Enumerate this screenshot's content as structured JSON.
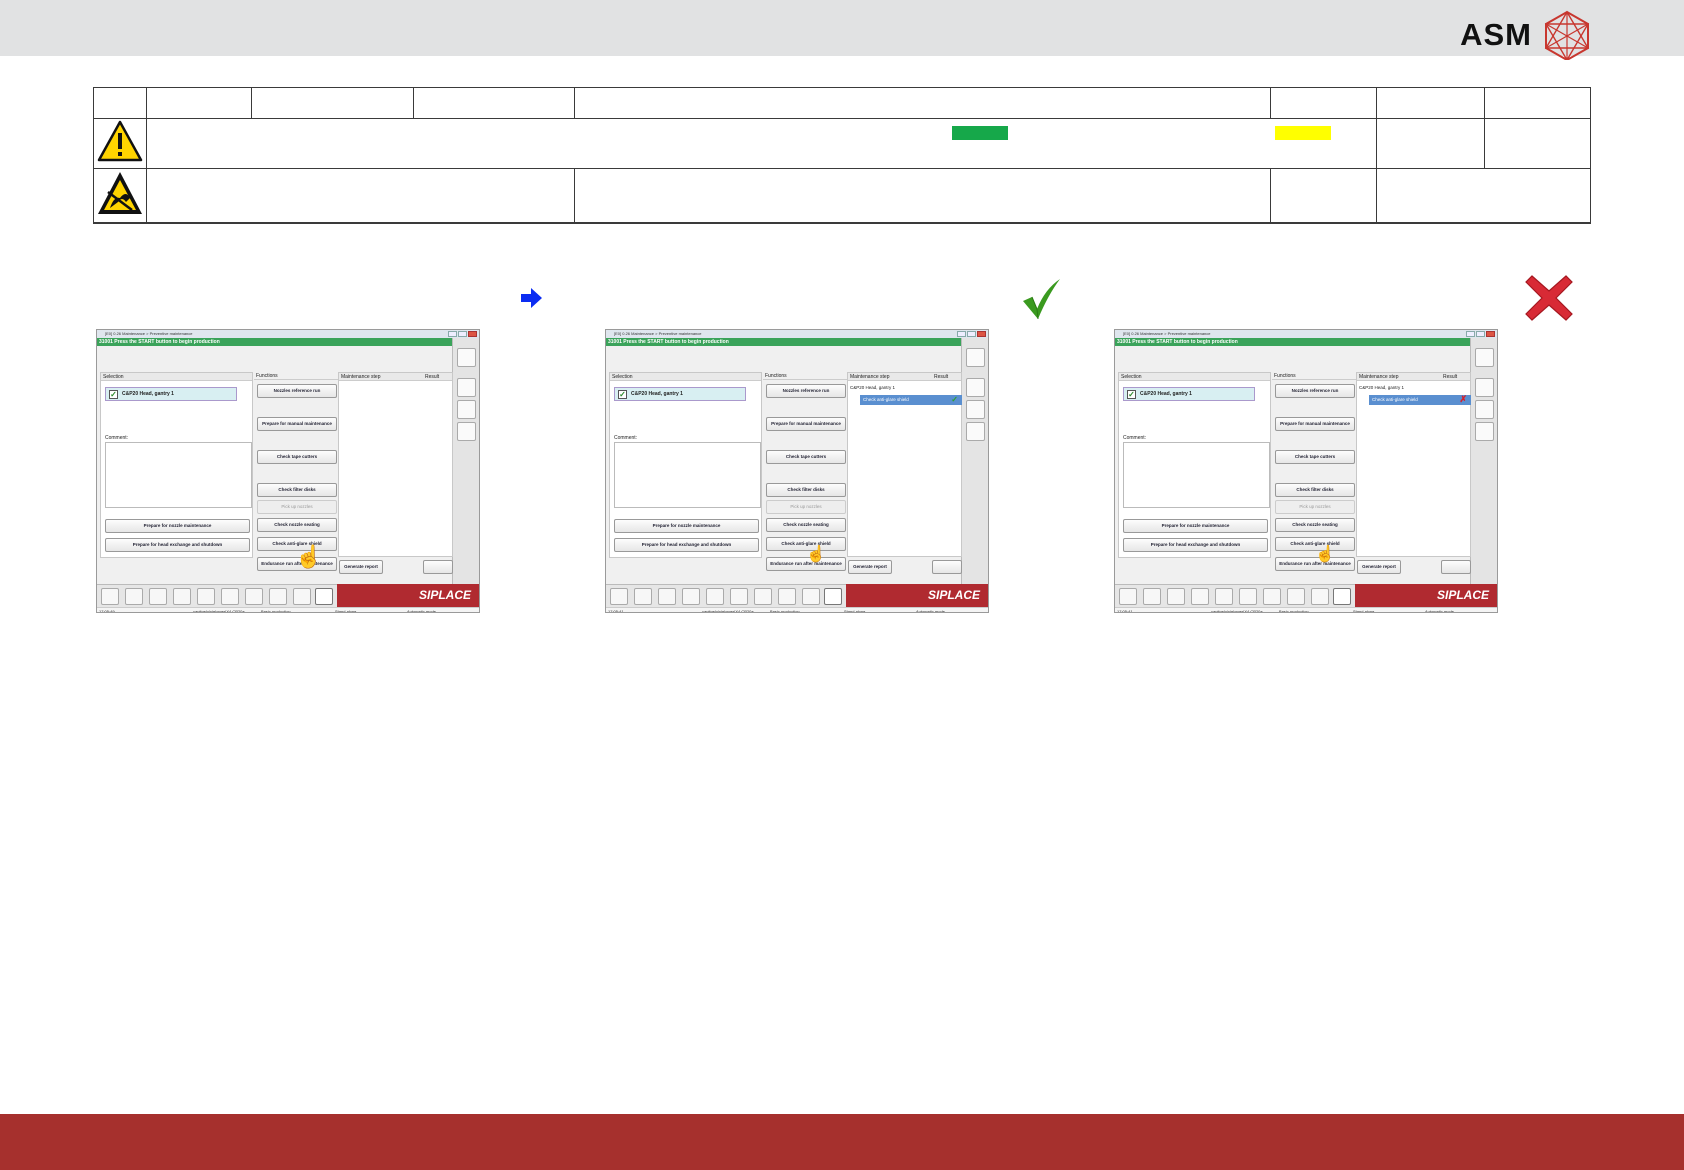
{
  "brand": {
    "logo_text": "ASM"
  },
  "colors": {
    "header_band": "#e1e2e3",
    "footer_band": "#a6302d",
    "swatch_green": "#16a84a",
    "swatch_yellow": "#ffff00",
    "arrow_blue": "#0b2cf2",
    "check_green": "#3a9a1f",
    "cross_red": "#d82a35"
  },
  "markers": {
    "arrow": "arrow-right-icon",
    "check": "check-icon",
    "cross": "cross-icon"
  },
  "screens": [
    {
      "title": "[E0] 0.26 Maintenance > Preventive maintenance",
      "status_message": "31001 Press the START button to begin production",
      "selection_header": "Selection",
      "selection_item": "C&P20 Head, gantry 1",
      "comment_label": "Comment:",
      "functions_header": "Functions",
      "maintenance_header": "Maintenance step",
      "result_header": "Result",
      "maint_head_label": "",
      "step_label": "",
      "result": "none",
      "buttons": {
        "nozzle_ref": "Nozzles reference run",
        "prepare_manual": "Prepare for manual maintenance",
        "check_tape": "Check tape cutters",
        "check_filter": "Check filter disks",
        "pick_up": "Pick up nozzles",
        "check_nozzle_seating": "Check nozzle seating",
        "check_anti_glare": "Check anti-glare shield",
        "endurance": "Endurance run after maintenance",
        "generate_report": "Generate report",
        "prepare_nozzle": "Prepare for nozzle maintenance",
        "prepare_head": "Prepare for head exchange and shutdown"
      },
      "brand": "SIPLACE",
      "footer": {
        "time": "17:05:49",
        "station": "captinelo\\sielomer\\X4 CP20a",
        "mode1": "Basic production",
        "mode2": "Stand alone",
        "mode3": "Automatic mode"
      }
    },
    {
      "title": "[E0] 0.26 Maintenance > Preventive maintenance",
      "status_message": "31001 Press the START button to begin production",
      "selection_header": "Selection",
      "selection_item": "C&P20 Head, gantry 1",
      "comment_label": "Comment:",
      "functions_header": "Functions",
      "maintenance_header": "Maintenance step",
      "result_header": "Result",
      "maint_head_label": "C&P20 Head, gantry 1",
      "step_label": "Check anti-glare shield",
      "result": "ok",
      "buttons": {
        "nozzle_ref": "Nozzles reference run",
        "prepare_manual": "Prepare for manual maintenance",
        "check_tape": "Check tape cutters",
        "check_filter": "Check filter disks",
        "pick_up": "Pick up nozzles",
        "check_nozzle_seating": "Check nozzle seating",
        "check_anti_glare": "Check anti-glare shield",
        "endurance": "Endurance run after maintenance",
        "generate_report": "Generate report",
        "prepare_nozzle": "Prepare for nozzle maintenance",
        "prepare_head": "Prepare for head exchange and shutdown"
      },
      "brand": "SIPLACE",
      "footer": {
        "time": "17:05:41",
        "station": "captinelo\\sielomer\\X4 CP20a",
        "mode1": "Basic production",
        "mode2": "Stand alone",
        "mode3": "Automatic mode"
      }
    },
    {
      "title": "[E0] 0.26 Maintenance > Preventive maintenance",
      "status_message": "31001 Press the START button to begin production",
      "selection_header": "Selection",
      "selection_item": "C&P20 Head, gantry 1",
      "comment_label": "Comment:",
      "functions_header": "Functions",
      "maintenance_header": "Maintenance step",
      "result_header": "Result",
      "maint_head_label": "C&P20 Head, gantry 1",
      "step_label": "Check anti-glare shield",
      "result": "fail",
      "buttons": {
        "nozzle_ref": "Nozzles reference run",
        "prepare_manual": "Prepare for manual maintenance",
        "check_tape": "Check tape cutters",
        "check_filter": "Check filter disks",
        "pick_up": "Pick up nozzles",
        "check_nozzle_seating": "Check nozzle seating",
        "check_anti_glare": "Check anti-glare shield",
        "endurance": "Endurance run after maintenance",
        "generate_report": "Generate report",
        "prepare_nozzle": "Prepare for nozzle maintenance",
        "prepare_head": "Prepare for head exchange and shutdown"
      },
      "brand": "SIPLACE",
      "footer": {
        "time": "17:05:41",
        "station": "captinelo\\sielomer\\X4 CP20a",
        "mode1": "Basic production",
        "mode2": "Stand alone",
        "mode3": "Automatic mode"
      }
    }
  ]
}
